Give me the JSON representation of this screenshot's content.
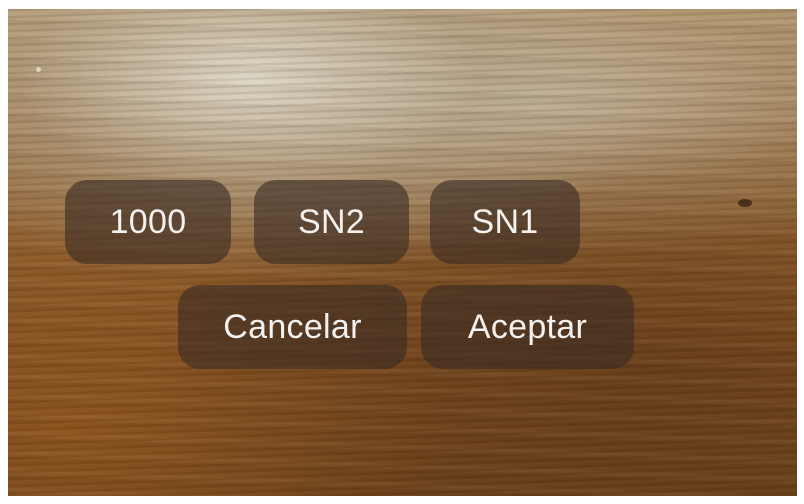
{
  "options": [
    {
      "label": "1000"
    },
    {
      "label": "SN2"
    },
    {
      "label": "SN1"
    }
  ],
  "actions": {
    "cancel_label": "Cancelar",
    "accept_label": "Aceptar"
  },
  "colors": {
    "button_bg": "#3a2c24",
    "button_text": "#f4f1ee"
  }
}
